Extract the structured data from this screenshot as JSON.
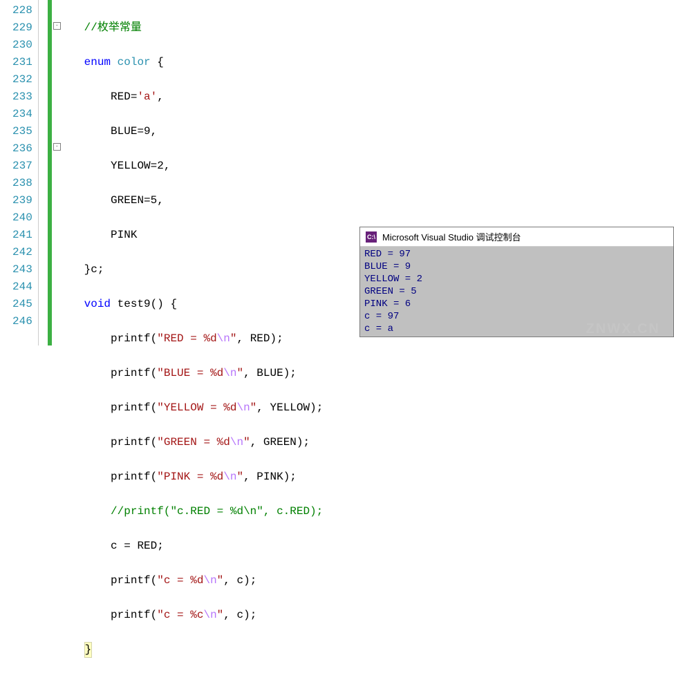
{
  "lines": [
    {
      "num": "228"
    },
    {
      "num": "229"
    },
    {
      "num": "230"
    },
    {
      "num": "231"
    },
    {
      "num": "232"
    },
    {
      "num": "233"
    },
    {
      "num": "234"
    },
    {
      "num": "235"
    },
    {
      "num": "236"
    },
    {
      "num": "237"
    },
    {
      "num": "238"
    },
    {
      "num": "239"
    },
    {
      "num": "240"
    },
    {
      "num": "241"
    },
    {
      "num": "242"
    },
    {
      "num": "243"
    },
    {
      "num": "244"
    },
    {
      "num": "245"
    },
    {
      "num": "246"
    }
  ],
  "code": {
    "l228_comment": "//枚举常量",
    "l229_kw": "enum",
    "l229_type": " color",
    "l229_brace": " {",
    "l230_ident": "RED=",
    "l230_str": "'a'",
    "l230_p": ",",
    "l231": "BLUE=9,",
    "l232": "YELLOW=2,",
    "l233": "GREEN=5,",
    "l234": "PINK",
    "l235": "}c;",
    "l236_kw": "void",
    "l236_fn": " test9",
    "l236_p": "() {",
    "l237_fn": "printf",
    "l237_p1": "(",
    "l237_s1": "\"RED = %d",
    "l237_esc": "\\n",
    "l237_s2": "\"",
    "l237_p2": ", RED);",
    "l238_fn": "printf",
    "l238_p1": "(",
    "l238_s1": "\"BLUE = %d",
    "l238_esc": "\\n",
    "l238_s2": "\"",
    "l238_p2": ", BLUE);",
    "l239_fn": "printf",
    "l239_p1": "(",
    "l239_s1": "\"YELLOW = %d",
    "l239_esc": "\\n",
    "l239_s2": "\"",
    "l239_p2": ", YELLOW);",
    "l240_fn": "printf",
    "l240_p1": "(",
    "l240_s1": "\"GREEN = %d",
    "l240_esc": "\\n",
    "l240_s2": "\"",
    "l240_p2": ", GREEN);",
    "l241_fn": "printf",
    "l241_p1": "(",
    "l241_s1": "\"PINK = %d",
    "l241_esc": "\\n",
    "l241_s2": "\"",
    "l241_p2": ", PINK);",
    "l242_comment": "//printf(\"c.RED = %d\\n\", c.RED);",
    "l243": "c = RED;",
    "l244_fn": "printf",
    "l244_p1": "(",
    "l244_s1": "\"c = %d",
    "l244_esc": "\\n",
    "l244_s2": "\"",
    "l244_p2": ", c);",
    "l245_fn": "printf",
    "l245_p1": "(",
    "l245_s1": "\"c = %c",
    "l245_esc": "\\n",
    "l245_s2": "\"",
    "l245_p2": ", c);",
    "l246": "}"
  },
  "fold": {
    "minus": "-"
  },
  "console": {
    "icon": "C:\\",
    "title": "Microsoft Visual Studio 调试控制台",
    "out1": "RED = 97",
    "out2": "BLUE = 9",
    "out3": "YELLOW = 2",
    "out4": "GREEN = 5",
    "out5": "PINK = 6",
    "out6": "c = 97",
    "out7": "c = a"
  },
  "watermark": "ZNWX.CN"
}
